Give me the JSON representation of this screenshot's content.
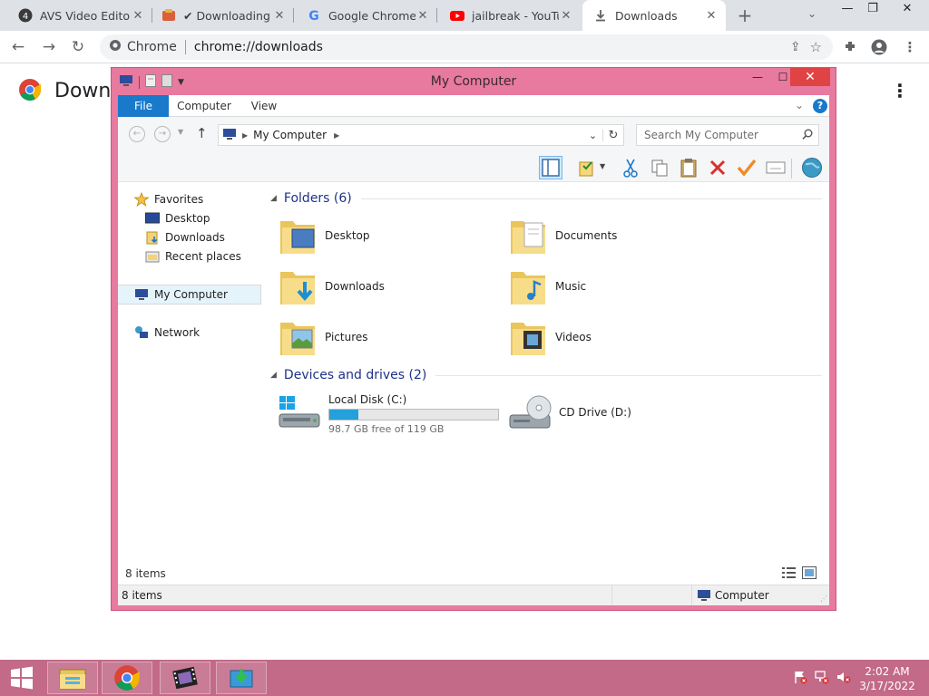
{
  "browser": {
    "tabs": [
      {
        "title": "AVS Video Editor",
        "icon": "avs-icon"
      },
      {
        "title": "✔ Downloading",
        "icon": "store-icon"
      },
      {
        "title": "Google Chrome H",
        "icon": "google-icon"
      },
      {
        "title": "jailbreak - YouTub",
        "icon": "youtube-icon"
      },
      {
        "title": "Downloads",
        "icon": "download-icon"
      }
    ],
    "active_tab": 4,
    "omnibox": {
      "site": "Chrome",
      "url": "chrome://downloads"
    },
    "page_title": "Down"
  },
  "explorer": {
    "title": "My Computer",
    "ribbon_tabs": [
      "File",
      "Computer",
      "View"
    ],
    "address": "My Computer",
    "search_placeholder": "Search My Computer",
    "nav": {
      "favorites": "Favorites",
      "favorite_items": [
        "Desktop",
        "Downloads",
        "Recent places"
      ],
      "computer": "My Computer",
      "network": "Network"
    },
    "folders_header": "Folders (6)",
    "folders": [
      "Desktop",
      "Documents",
      "Downloads",
      "Music",
      "Pictures",
      "Videos"
    ],
    "devices_header": "Devices and drives (2)",
    "drives": [
      {
        "name": "Local Disk (C:)",
        "free": "98.7 GB free of 119 GB",
        "used_fraction": 0.17
      },
      {
        "name": "CD Drive (D:)"
      }
    ],
    "item_count": "8 items",
    "status_count": "8 items",
    "status_location": "Computer"
  },
  "taskbar": {
    "time": "2:02 AM",
    "date": "3/17/2022"
  },
  "colors": {
    "window_frame": "#e8799f",
    "taskbar": "#c26a88",
    "ribbon_file": "#1979ca",
    "drive_fill": "#26a0da",
    "folder_header": "#1e3287"
  }
}
